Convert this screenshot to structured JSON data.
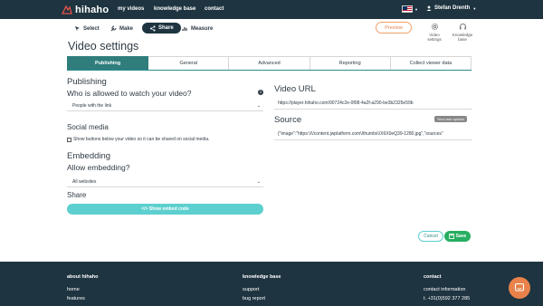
{
  "nav": {
    "logo_text": "hihaho",
    "links": [
      "my videos",
      "knowledge base",
      "contact"
    ],
    "user_name": "Stefan Drenth"
  },
  "steps": {
    "select": "Select",
    "make": "Make",
    "share": "Share",
    "measure": "Measure"
  },
  "toolbar": {
    "preview": "Preview",
    "video_settings": [
      "Video",
      "settings"
    ],
    "knowledge_base": [
      "Knowledge",
      "base"
    ]
  },
  "page_title": "Video settings",
  "tabs": [
    "Publishing",
    "General",
    "Advanced",
    "Reporting",
    "Collect viewer data"
  ],
  "publishing": {
    "heading": "Publishing",
    "question": "Who is allowed to watch your video?",
    "select_value": "People with the link"
  },
  "social": {
    "heading": "Social media",
    "checkbox_label": "Show buttons below your video so it can be shared on social media."
  },
  "embedding": {
    "heading": "Embedding",
    "question": "Allow embedding?",
    "select_value": "All websites"
  },
  "share": {
    "heading": "Share",
    "button": "</> Show embed code"
  },
  "video_url": {
    "heading": "Video URL",
    "value": "https://player.hihaho.com/90724c2e-0f08-4a2f-a290-be3b2325e59b"
  },
  "source": {
    "heading": "Source",
    "badge": "Your own upload",
    "value": "{\"image\":\"https:\\/\\/content.jwplatform.com\\/thumbs\\/X6X0eQ39-1280.jpg\",\"sources\""
  },
  "actions": {
    "cancel": "Cancel",
    "save": "Save"
  },
  "footer": {
    "col1_heading": "about hihaho",
    "col1_links": [
      "home",
      "features"
    ],
    "col2_heading": "knowledge base",
    "col2_links": [
      "support",
      "bug report"
    ],
    "col3_heading": "contact",
    "col3_links": [
      "contact information",
      "t. +31(0)592 377 285"
    ]
  },
  "colors": {
    "navy": "#1e3440",
    "teal": "#2f7d7d",
    "aqua": "#5dcfcf",
    "green": "#27ae60",
    "orange": "#e8824a"
  }
}
